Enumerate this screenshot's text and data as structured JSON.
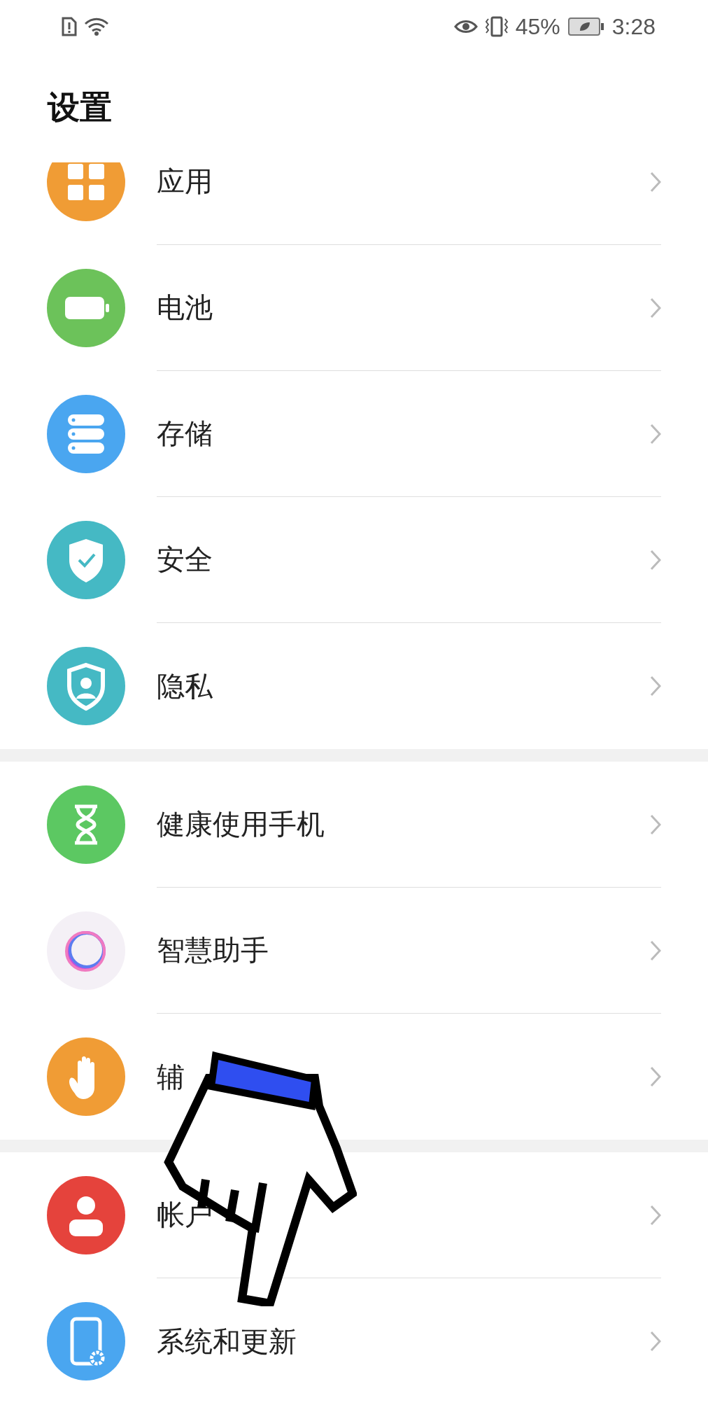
{
  "status_bar": {
    "battery_percent": "45%",
    "time": "3:28"
  },
  "title": "设置",
  "groups": [
    {
      "items": [
        {
          "label": "应用",
          "kind": "apps",
          "color": "#f09c35"
        },
        {
          "label": "电池",
          "kind": "battery",
          "color": "#6cc25a"
        },
        {
          "label": "存储",
          "kind": "storage",
          "color": "#4aa6f0"
        },
        {
          "label": "安全",
          "kind": "security",
          "color": "#45b9c4"
        },
        {
          "label": "隐私",
          "kind": "privacy",
          "color": "#45b9c4"
        }
      ]
    },
    {
      "items": [
        {
          "label": "健康使用手机",
          "kind": "health",
          "color": "#5cc862"
        },
        {
          "label": "智慧助手",
          "kind": "assistant",
          "color": "#f4f0f6"
        },
        {
          "label": "辅",
          "kind": "accessibility",
          "color": "#f09c35"
        }
      ]
    },
    {
      "items": [
        {
          "label": "帐户",
          "kind": "account",
          "color": "#e5433c"
        },
        {
          "label": "系统和更新",
          "kind": "system",
          "color": "#4aa6f0"
        }
      ]
    }
  ]
}
